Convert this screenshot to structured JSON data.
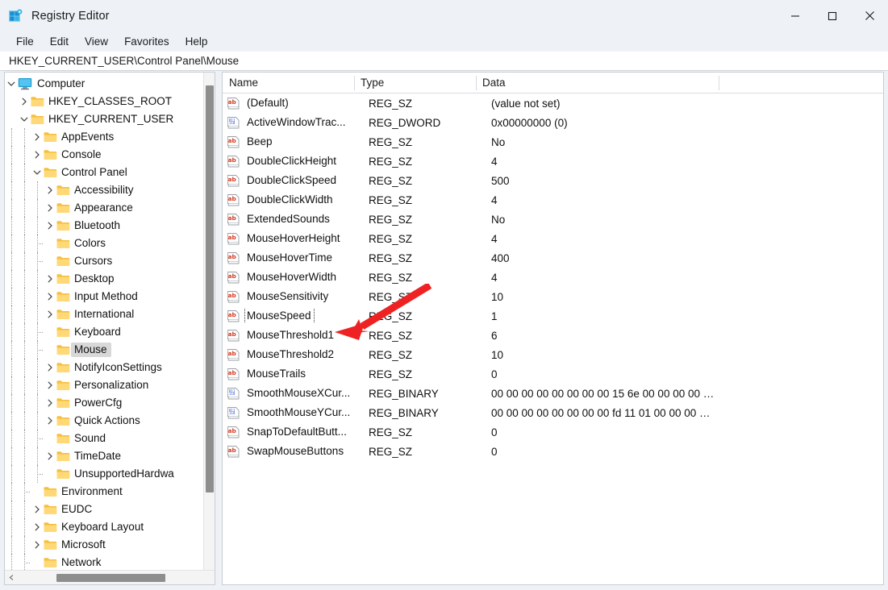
{
  "window": {
    "title": "Registry Editor",
    "icon": "registry-icon",
    "controls": {
      "minimize": "minimize-icon",
      "maximize": "maximize-icon",
      "close": "close-icon"
    }
  },
  "menubar": {
    "items": [
      {
        "label": "File"
      },
      {
        "label": "Edit"
      },
      {
        "label": "View"
      },
      {
        "label": "Favorites"
      },
      {
        "label": "Help"
      }
    ]
  },
  "address": {
    "path": "HKEY_CURRENT_USER\\Control Panel\\Mouse"
  },
  "tree": {
    "items": [
      {
        "label": "Computer",
        "indent": 0,
        "twisty": "expanded",
        "icon": "computer-icon",
        "guide": "none",
        "selected": false
      },
      {
        "label": "HKEY_CLASSES_ROOT",
        "indent": 1,
        "twisty": "collapsed",
        "icon": "folder-icon",
        "guide": "none",
        "selected": false
      },
      {
        "label": "HKEY_CURRENT_USER",
        "indent": 1,
        "twisty": "expanded",
        "icon": "folder-icon",
        "guide": "none",
        "selected": false
      },
      {
        "label": "AppEvents",
        "indent": 2,
        "twisty": "collapsed",
        "icon": "folder-icon",
        "guide": "vline",
        "selected": false
      },
      {
        "label": "Console",
        "indent": 2,
        "twisty": "collapsed",
        "icon": "folder-icon",
        "guide": "vline",
        "selected": false
      },
      {
        "label": "Control Panel",
        "indent": 2,
        "twisty": "expanded",
        "icon": "folder-icon",
        "guide": "vline",
        "selected": false
      },
      {
        "label": "Accessibility",
        "indent": 3,
        "twisty": "collapsed",
        "icon": "folder-icon",
        "guide": "vline",
        "selected": false
      },
      {
        "label": "Appearance",
        "indent": 3,
        "twisty": "collapsed",
        "icon": "folder-icon",
        "guide": "vline",
        "selected": false
      },
      {
        "label": "Bluetooth",
        "indent": 3,
        "twisty": "collapsed",
        "icon": "folder-icon",
        "guide": "vline",
        "selected": false
      },
      {
        "label": "Colors",
        "indent": 3,
        "twisty": "none",
        "icon": "folder-icon",
        "guide": "vline",
        "selected": false
      },
      {
        "label": "Cursors",
        "indent": 3,
        "twisty": "none",
        "icon": "folder-icon",
        "guide": "vline",
        "selected": false
      },
      {
        "label": "Desktop",
        "indent": 3,
        "twisty": "collapsed",
        "icon": "folder-icon",
        "guide": "vline",
        "selected": false
      },
      {
        "label": "Input Method",
        "indent": 3,
        "twisty": "collapsed",
        "icon": "folder-icon",
        "guide": "vline",
        "selected": false
      },
      {
        "label": "International",
        "indent": 3,
        "twisty": "collapsed",
        "icon": "folder-icon",
        "guide": "vline",
        "selected": false
      },
      {
        "label": "Keyboard",
        "indent": 3,
        "twisty": "none",
        "icon": "folder-icon",
        "guide": "vline",
        "selected": false
      },
      {
        "label": "Mouse",
        "indent": 3,
        "twisty": "none",
        "icon": "folder-icon",
        "guide": "vline",
        "selected": true
      },
      {
        "label": "NotifyIconSettings",
        "indent": 3,
        "twisty": "collapsed",
        "icon": "folder-icon",
        "guide": "vline",
        "selected": false
      },
      {
        "label": "Personalization",
        "indent": 3,
        "twisty": "collapsed",
        "icon": "folder-icon",
        "guide": "vline",
        "selected": false
      },
      {
        "label": "PowerCfg",
        "indent": 3,
        "twisty": "collapsed",
        "icon": "folder-icon",
        "guide": "vline",
        "selected": false
      },
      {
        "label": "Quick Actions",
        "indent": 3,
        "twisty": "collapsed",
        "icon": "folder-icon",
        "guide": "vline",
        "selected": false
      },
      {
        "label": "Sound",
        "indent": 3,
        "twisty": "none",
        "icon": "folder-icon",
        "guide": "vline",
        "selected": false
      },
      {
        "label": "TimeDate",
        "indent": 3,
        "twisty": "collapsed",
        "icon": "folder-icon",
        "guide": "vline",
        "selected": false
      },
      {
        "label": "UnsupportedHardwa",
        "indent": 3,
        "twisty": "none",
        "icon": "folder-icon",
        "guide": "vline",
        "selected": false
      },
      {
        "label": "Environment",
        "indent": 2,
        "twisty": "none",
        "icon": "folder-icon",
        "guide": "vline",
        "selected": false
      },
      {
        "label": "EUDC",
        "indent": 2,
        "twisty": "collapsed",
        "icon": "folder-icon",
        "guide": "vline",
        "selected": false
      },
      {
        "label": "Keyboard Layout",
        "indent": 2,
        "twisty": "collapsed",
        "icon": "folder-icon",
        "guide": "vline",
        "selected": false
      },
      {
        "label": "Microsoft",
        "indent": 2,
        "twisty": "collapsed",
        "icon": "folder-icon",
        "guide": "vline",
        "selected": false
      },
      {
        "label": "Network",
        "indent": 2,
        "twisty": "none",
        "icon": "folder-icon",
        "guide": "vline",
        "selected": false
      }
    ]
  },
  "list": {
    "columns": [
      {
        "label": "Name"
      },
      {
        "label": "Type"
      },
      {
        "label": "Data"
      },
      {
        "label": ""
      }
    ],
    "rows": [
      {
        "icon": "string-value-icon",
        "name": "(Default)",
        "type": "REG_SZ",
        "data": "(value not set)",
        "focused": false
      },
      {
        "icon": "binary-value-icon",
        "name": "ActiveWindowTrac...",
        "type": "REG_DWORD",
        "data": "0x00000000 (0)",
        "focused": false
      },
      {
        "icon": "string-value-icon",
        "name": "Beep",
        "type": "REG_SZ",
        "data": "No",
        "focused": false
      },
      {
        "icon": "string-value-icon",
        "name": "DoubleClickHeight",
        "type": "REG_SZ",
        "data": "4",
        "focused": false
      },
      {
        "icon": "string-value-icon",
        "name": "DoubleClickSpeed",
        "type": "REG_SZ",
        "data": "500",
        "focused": false
      },
      {
        "icon": "string-value-icon",
        "name": "DoubleClickWidth",
        "type": "REG_SZ",
        "data": "4",
        "focused": false
      },
      {
        "icon": "string-value-icon",
        "name": "ExtendedSounds",
        "type": "REG_SZ",
        "data": "No",
        "focused": false
      },
      {
        "icon": "string-value-icon",
        "name": "MouseHoverHeight",
        "type": "REG_SZ",
        "data": "4",
        "focused": false
      },
      {
        "icon": "string-value-icon",
        "name": "MouseHoverTime",
        "type": "REG_SZ",
        "data": "400",
        "focused": false
      },
      {
        "icon": "string-value-icon",
        "name": "MouseHoverWidth",
        "type": "REG_SZ",
        "data": "4",
        "focused": false
      },
      {
        "icon": "string-value-icon",
        "name": "MouseSensitivity",
        "type": "REG_SZ",
        "data": "10",
        "focused": false
      },
      {
        "icon": "string-value-icon",
        "name": "MouseSpeed",
        "type": "REG_SZ",
        "data": "1",
        "focused": true
      },
      {
        "icon": "string-value-icon",
        "name": "MouseThreshold1",
        "type": "REG_SZ",
        "data": "6",
        "focused": false
      },
      {
        "icon": "string-value-icon",
        "name": "MouseThreshold2",
        "type": "REG_SZ",
        "data": "10",
        "focused": false
      },
      {
        "icon": "string-value-icon",
        "name": "MouseTrails",
        "type": "REG_SZ",
        "data": "0",
        "focused": false
      },
      {
        "icon": "binary-value-icon",
        "name": "SmoothMouseXCur...",
        "type": "REG_BINARY",
        "data": "00 00 00 00 00 00 00 00 15 6e 00 00 00 00 …",
        "focused": false
      },
      {
        "icon": "binary-value-icon",
        "name": "SmoothMouseYCur...",
        "type": "REG_BINARY",
        "data": "00 00 00 00 00 00 00 00 fd 11 01 00 00 00 …",
        "focused": false
      },
      {
        "icon": "string-value-icon",
        "name": "SnapToDefaultButt...",
        "type": "REG_SZ",
        "data": "0",
        "focused": false
      },
      {
        "icon": "string-value-icon",
        "name": "SwapMouseButtons",
        "type": "REG_SZ",
        "data": "0",
        "focused": false
      }
    ]
  },
  "annotation": {
    "arrow": "red-arrow-pointer",
    "color": "#ee2222",
    "points_at": "MouseThreshold1"
  },
  "colors": {
    "chrome": "#eef2f7",
    "panel": "#ffffff",
    "selection": "#d8d8d8",
    "folder": "#ffd04d",
    "accent": "#0b7ec4"
  }
}
